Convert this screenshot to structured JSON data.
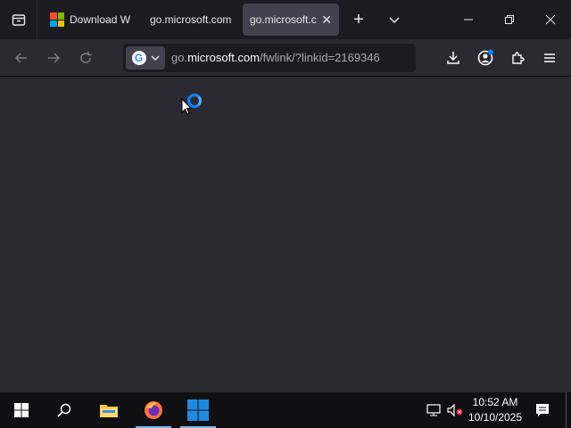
{
  "browser": {
    "tabs": [
      {
        "label": "Download W",
        "icon": "microsoft-logo-icon",
        "active": false
      },
      {
        "label": "go.microsoft.com",
        "active": false
      },
      {
        "label": "go.microsoft.c",
        "active": true
      }
    ],
    "url": {
      "prefix": "go.",
      "host": "microsoft.com",
      "path": "/fwlink/?linkid=2169346"
    },
    "search_engine": "Google",
    "search_engine_letter": "G"
  },
  "taskbar": {
    "time": "10:52 AM",
    "date": "10/10/2025",
    "items": [
      "start-button",
      "search-button",
      "file-explorer",
      "firefox",
      "windows-app"
    ]
  },
  "colors": {
    "accent": "#0a84ff",
    "tab_active": "#42414d",
    "content_bg": "#2b2a33",
    "taskbar_bg": "#101013"
  }
}
